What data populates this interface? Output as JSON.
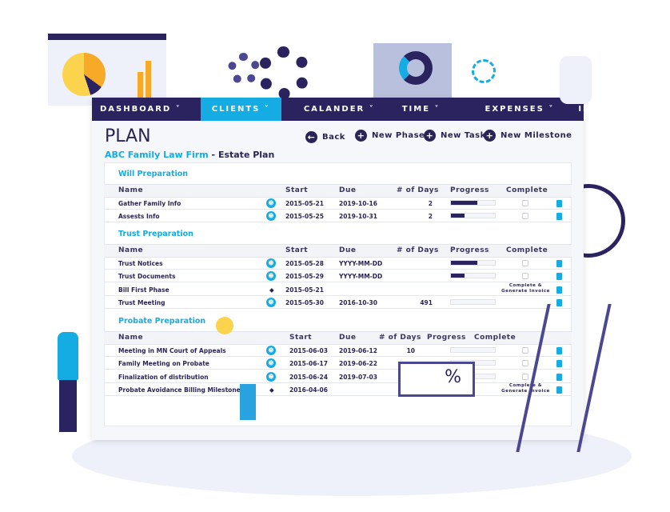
{
  "nav": [
    "DASHBOARD",
    "CLIENTS",
    "CALANDER",
    "TIME",
    "EXPENSES",
    "INVOICES"
  ],
  "nav_active": "CLIENTS",
  "title": "PLAN",
  "subtitle": {
    "firm": "ABC Family Law Firm",
    "sep": " - ",
    "plan": "Estate Plan"
  },
  "actions": {
    "back": "Back",
    "new_phase": "New Phase",
    "new_task": "New Task",
    "new_milestone": "New Milestone"
  },
  "columns": {
    "name": "Name",
    "start": "Start",
    "due": "Due",
    "days": "# of Days",
    "progress": "Progress",
    "complete": "Complete"
  },
  "complete_invoice": "Complete & Generate Invoice",
  "sections": [
    {
      "title": "Will Preparation",
      "rows": [
        {
          "name": "Gather Family Info",
          "type": "task",
          "start": "2015-05-21",
          "due": "2019-10-16",
          "days": "2",
          "progress": 0.6
        },
        {
          "name": "Assests Info",
          "type": "task",
          "start": "2015-05-25",
          "due": "2019-10-31",
          "days": "2",
          "progress": 0.3
        }
      ]
    },
    {
      "title": "Trust Preparation",
      "rows": [
        {
          "name": "Trust Notices",
          "type": "task",
          "start": "2015-05-28",
          "due": "YYYY-MM-DD",
          "days": "",
          "progress": 0.6
        },
        {
          "name": "Trust Documents",
          "type": "task",
          "start": "2015-05-29",
          "due": "YYYY-MM-DD",
          "days": "",
          "progress": 0.3
        },
        {
          "name": "Bill First Phase",
          "type": "milestone",
          "start": "2015-05-21",
          "due": "",
          "days": ""
        },
        {
          "name": "Trust Meeting",
          "type": "task",
          "start": "2015-05-30",
          "due": "2016-10-30",
          "days": "491",
          "progress": 0,
          "nocheck": true
        }
      ]
    },
    {
      "title": "Probate Preparation",
      "rows": [
        {
          "name": "Meeting in MN Court of Appeals",
          "type": "task",
          "start": "2015-06-03",
          "due": "2019-06-12",
          "days": "10",
          "progress": 0
        },
        {
          "name": "Family Meeting on Probate",
          "type": "task",
          "start": "2015-06-17",
          "due": "2019-06-22",
          "days": "",
          "progress": 0
        },
        {
          "name": "Finalization of distribution",
          "type": "task",
          "start": "2015-06-24",
          "due": "2019-07-03",
          "days": "",
          "progress": 0
        },
        {
          "name": "Probate Avoidance Billing Milestone",
          "type": "milestone",
          "start": "2016-04-06",
          "due": "",
          "days": ""
        }
      ]
    }
  ],
  "colors": {
    "navy": "#2a2360",
    "accent": "#14ace3"
  },
  "icons": {
    "back": "arrow-left-circle",
    "add": "plus-circle",
    "group": "people-icon",
    "milestone": "diamond",
    "edit": "edit-doc",
    "more": "double-chevron"
  }
}
